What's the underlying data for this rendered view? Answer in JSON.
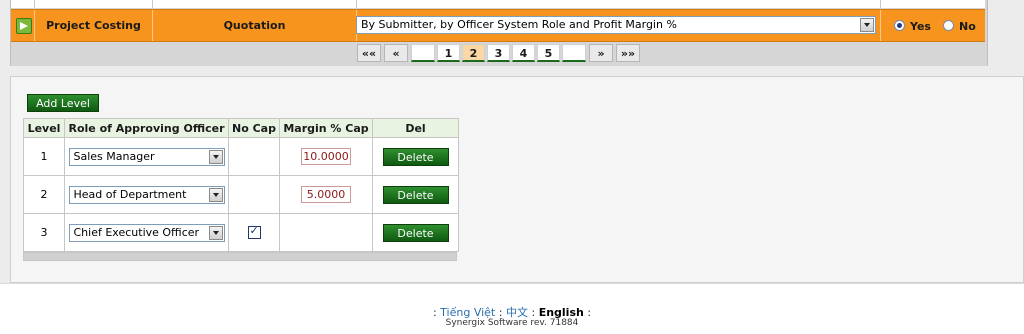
{
  "header": {
    "module": "Project Costing",
    "document": "Quotation",
    "approval_mode": "By Submitter, by Officer System Role and Profit Margin %",
    "yes_label": "Yes",
    "no_label": "No",
    "selected": "Yes"
  },
  "pager": {
    "first": "««",
    "prev": "«",
    "pages": [
      "1",
      "2",
      "3",
      "4",
      "5"
    ],
    "current": "2",
    "next": "»",
    "last": "»»"
  },
  "add_level_label": "Add Level",
  "table": {
    "headers": [
      "Level",
      "Role of Approving Officer",
      "No Cap",
      "Margin % Cap",
      "Del"
    ],
    "rows": [
      {
        "level": "1",
        "role": "Sales Manager",
        "no_cap": false,
        "margin": "10.0000",
        "del": "Delete"
      },
      {
        "level": "2",
        "role": "Head of Department",
        "no_cap": false,
        "margin": "5.0000",
        "del": "Delete"
      },
      {
        "level": "3",
        "role": "Chief Executive Officer",
        "no_cap": true,
        "margin": "",
        "del": "Delete"
      }
    ]
  },
  "footer": {
    "sep": ":",
    "lang_vi": "Tiếng Việt",
    "lang_zh": "中文",
    "lang_en": "English",
    "revision": "Synergix Software rev. 71884"
  },
  "colors": {
    "accent_orange": "#f7941d",
    "button_green": "#1f7a1f",
    "header_green": "#e8f3e2"
  }
}
